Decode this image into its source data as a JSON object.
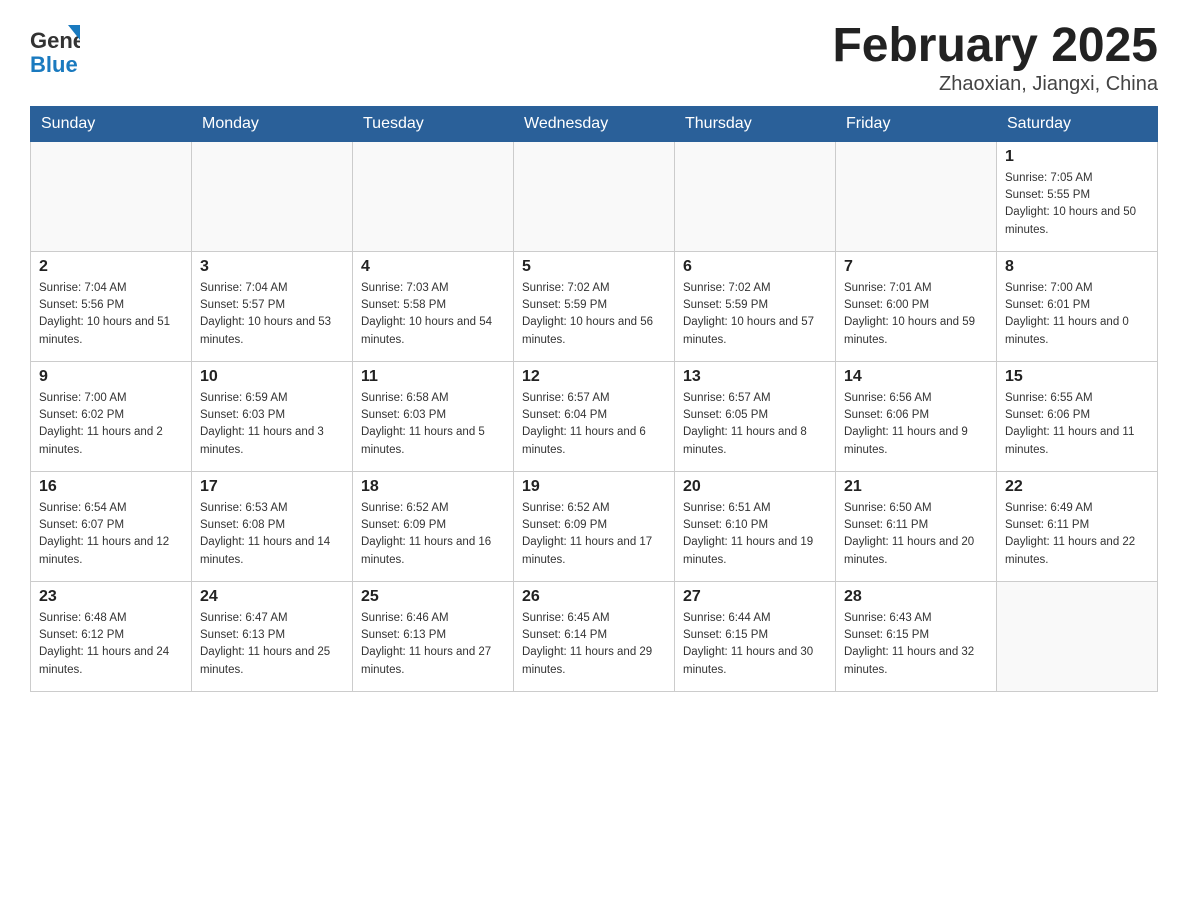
{
  "header": {
    "logo_general": "General",
    "logo_blue": "Blue",
    "title": "February 2025",
    "location": "Zhaoxian, Jiangxi, China"
  },
  "days_of_week": [
    "Sunday",
    "Monday",
    "Tuesday",
    "Wednesday",
    "Thursday",
    "Friday",
    "Saturday"
  ],
  "weeks": [
    [
      {
        "day": "",
        "sunrise": "",
        "sunset": "",
        "daylight": ""
      },
      {
        "day": "",
        "sunrise": "",
        "sunset": "",
        "daylight": ""
      },
      {
        "day": "",
        "sunrise": "",
        "sunset": "",
        "daylight": ""
      },
      {
        "day": "",
        "sunrise": "",
        "sunset": "",
        "daylight": ""
      },
      {
        "day": "",
        "sunrise": "",
        "sunset": "",
        "daylight": ""
      },
      {
        "day": "",
        "sunrise": "",
        "sunset": "",
        "daylight": ""
      },
      {
        "day": "1",
        "sunrise": "Sunrise: 7:05 AM",
        "sunset": "Sunset: 5:55 PM",
        "daylight": "Daylight: 10 hours and 50 minutes."
      }
    ],
    [
      {
        "day": "2",
        "sunrise": "Sunrise: 7:04 AM",
        "sunset": "Sunset: 5:56 PM",
        "daylight": "Daylight: 10 hours and 51 minutes."
      },
      {
        "day": "3",
        "sunrise": "Sunrise: 7:04 AM",
        "sunset": "Sunset: 5:57 PM",
        "daylight": "Daylight: 10 hours and 53 minutes."
      },
      {
        "day": "4",
        "sunrise": "Sunrise: 7:03 AM",
        "sunset": "Sunset: 5:58 PM",
        "daylight": "Daylight: 10 hours and 54 minutes."
      },
      {
        "day": "5",
        "sunrise": "Sunrise: 7:02 AM",
        "sunset": "Sunset: 5:59 PM",
        "daylight": "Daylight: 10 hours and 56 minutes."
      },
      {
        "day": "6",
        "sunrise": "Sunrise: 7:02 AM",
        "sunset": "Sunset: 5:59 PM",
        "daylight": "Daylight: 10 hours and 57 minutes."
      },
      {
        "day": "7",
        "sunrise": "Sunrise: 7:01 AM",
        "sunset": "Sunset: 6:00 PM",
        "daylight": "Daylight: 10 hours and 59 minutes."
      },
      {
        "day": "8",
        "sunrise": "Sunrise: 7:00 AM",
        "sunset": "Sunset: 6:01 PM",
        "daylight": "Daylight: 11 hours and 0 minutes."
      }
    ],
    [
      {
        "day": "9",
        "sunrise": "Sunrise: 7:00 AM",
        "sunset": "Sunset: 6:02 PM",
        "daylight": "Daylight: 11 hours and 2 minutes."
      },
      {
        "day": "10",
        "sunrise": "Sunrise: 6:59 AM",
        "sunset": "Sunset: 6:03 PM",
        "daylight": "Daylight: 11 hours and 3 minutes."
      },
      {
        "day": "11",
        "sunrise": "Sunrise: 6:58 AM",
        "sunset": "Sunset: 6:03 PM",
        "daylight": "Daylight: 11 hours and 5 minutes."
      },
      {
        "day": "12",
        "sunrise": "Sunrise: 6:57 AM",
        "sunset": "Sunset: 6:04 PM",
        "daylight": "Daylight: 11 hours and 6 minutes."
      },
      {
        "day": "13",
        "sunrise": "Sunrise: 6:57 AM",
        "sunset": "Sunset: 6:05 PM",
        "daylight": "Daylight: 11 hours and 8 minutes."
      },
      {
        "day": "14",
        "sunrise": "Sunrise: 6:56 AM",
        "sunset": "Sunset: 6:06 PM",
        "daylight": "Daylight: 11 hours and 9 minutes."
      },
      {
        "day": "15",
        "sunrise": "Sunrise: 6:55 AM",
        "sunset": "Sunset: 6:06 PM",
        "daylight": "Daylight: 11 hours and 11 minutes."
      }
    ],
    [
      {
        "day": "16",
        "sunrise": "Sunrise: 6:54 AM",
        "sunset": "Sunset: 6:07 PM",
        "daylight": "Daylight: 11 hours and 12 minutes."
      },
      {
        "day": "17",
        "sunrise": "Sunrise: 6:53 AM",
        "sunset": "Sunset: 6:08 PM",
        "daylight": "Daylight: 11 hours and 14 minutes."
      },
      {
        "day": "18",
        "sunrise": "Sunrise: 6:52 AM",
        "sunset": "Sunset: 6:09 PM",
        "daylight": "Daylight: 11 hours and 16 minutes."
      },
      {
        "day": "19",
        "sunrise": "Sunrise: 6:52 AM",
        "sunset": "Sunset: 6:09 PM",
        "daylight": "Daylight: 11 hours and 17 minutes."
      },
      {
        "day": "20",
        "sunrise": "Sunrise: 6:51 AM",
        "sunset": "Sunset: 6:10 PM",
        "daylight": "Daylight: 11 hours and 19 minutes."
      },
      {
        "day": "21",
        "sunrise": "Sunrise: 6:50 AM",
        "sunset": "Sunset: 6:11 PM",
        "daylight": "Daylight: 11 hours and 20 minutes."
      },
      {
        "day": "22",
        "sunrise": "Sunrise: 6:49 AM",
        "sunset": "Sunset: 6:11 PM",
        "daylight": "Daylight: 11 hours and 22 minutes."
      }
    ],
    [
      {
        "day": "23",
        "sunrise": "Sunrise: 6:48 AM",
        "sunset": "Sunset: 6:12 PM",
        "daylight": "Daylight: 11 hours and 24 minutes."
      },
      {
        "day": "24",
        "sunrise": "Sunrise: 6:47 AM",
        "sunset": "Sunset: 6:13 PM",
        "daylight": "Daylight: 11 hours and 25 minutes."
      },
      {
        "day": "25",
        "sunrise": "Sunrise: 6:46 AM",
        "sunset": "Sunset: 6:13 PM",
        "daylight": "Daylight: 11 hours and 27 minutes."
      },
      {
        "day": "26",
        "sunrise": "Sunrise: 6:45 AM",
        "sunset": "Sunset: 6:14 PM",
        "daylight": "Daylight: 11 hours and 29 minutes."
      },
      {
        "day": "27",
        "sunrise": "Sunrise: 6:44 AM",
        "sunset": "Sunset: 6:15 PM",
        "daylight": "Daylight: 11 hours and 30 minutes."
      },
      {
        "day": "28",
        "sunrise": "Sunrise: 6:43 AM",
        "sunset": "Sunset: 6:15 PM",
        "daylight": "Daylight: 11 hours and 32 minutes."
      },
      {
        "day": "",
        "sunrise": "",
        "sunset": "",
        "daylight": ""
      }
    ]
  ]
}
